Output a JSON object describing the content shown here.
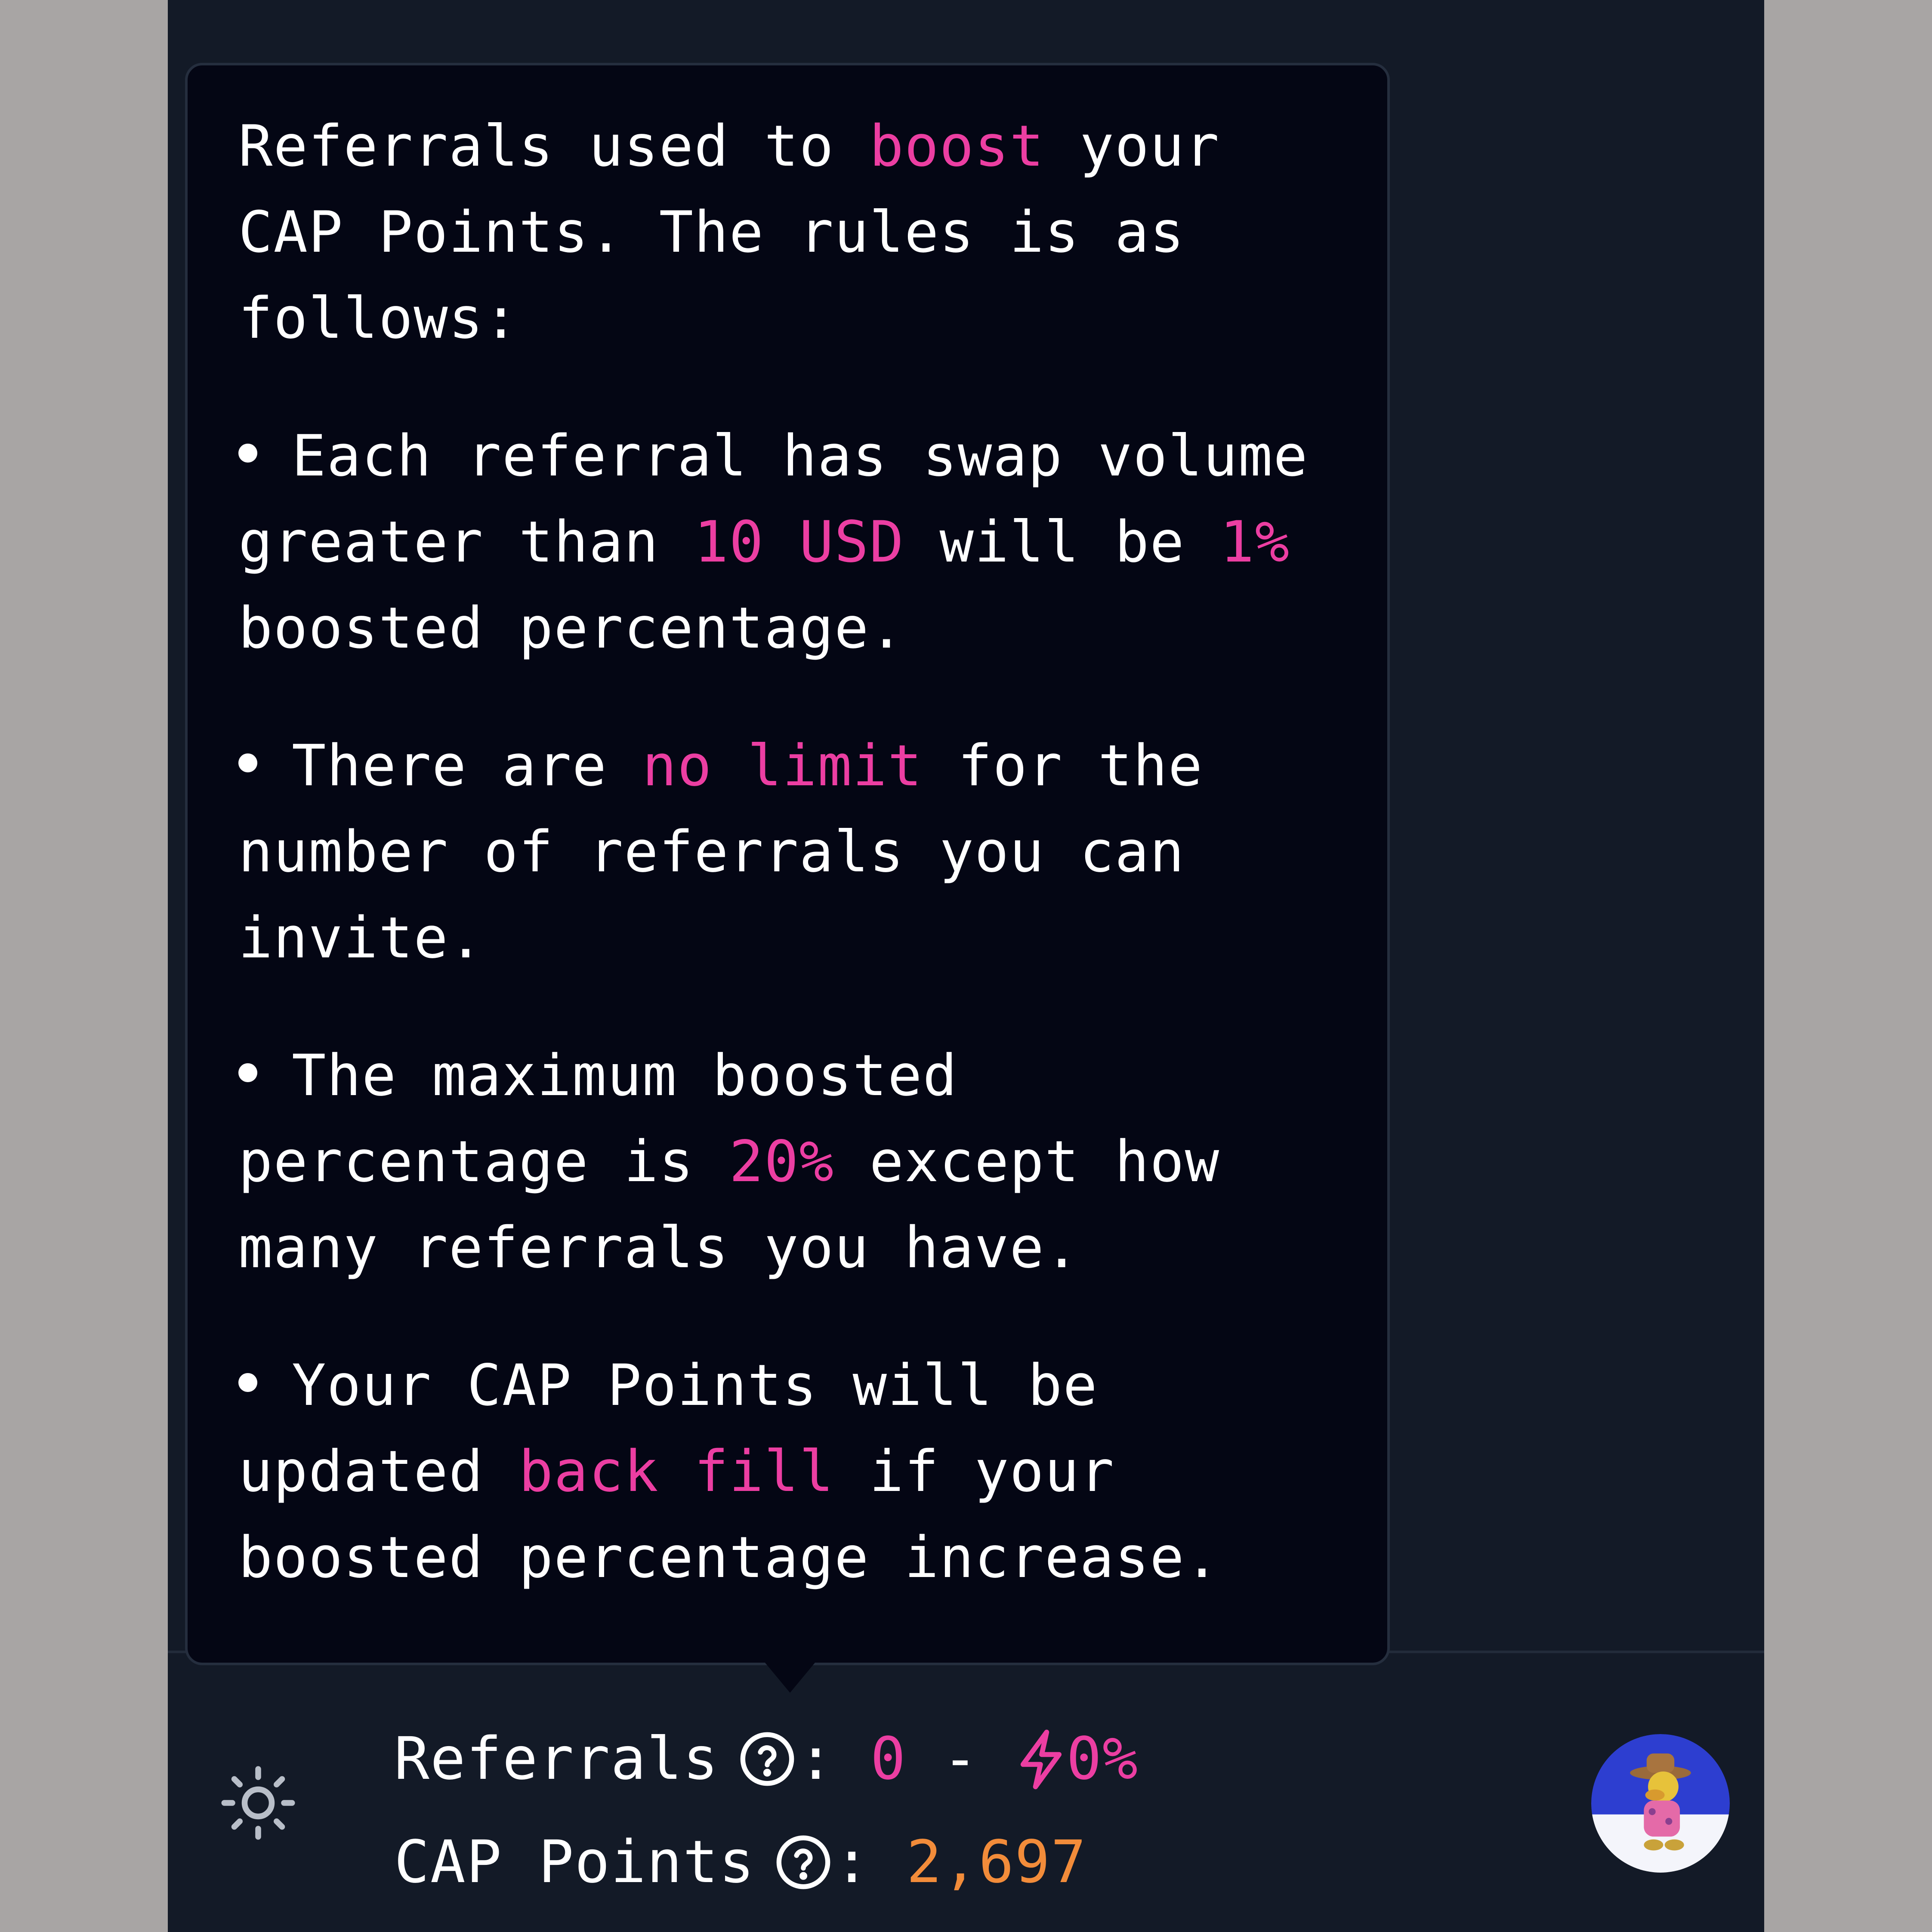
{
  "tooltip": {
    "intro": {
      "before": "Referrals used to ",
      "highlight": "boost",
      "after": " your CAP Points. The rules is as follows:"
    },
    "rules": [
      {
        "before": "Each referral has swap volume greater than ",
        "highlight": "10 USD",
        "middle": " will be ",
        "highlight2": "1%",
        "after": " boosted percentage."
      },
      {
        "before": "There are ",
        "highlight": "no limit",
        "after": " for the number of referrals you can invite."
      },
      {
        "before": "The maximum boosted percentage is ",
        "highlight": "20%",
        "after": " except how many referrals you have."
      },
      {
        "before": "Your CAP Points will be updated ",
        "highlight": "back fill",
        "after": " if your boosted percentage increase."
      }
    ]
  },
  "stats": {
    "referrals": {
      "label": "Referrals",
      "separator": ":",
      "count": "0",
      "dash": "-",
      "boost": "0%"
    },
    "cap_points": {
      "label": "CAP Points",
      "separator": ":",
      "value": "2,697"
    }
  },
  "icons": {
    "theme_toggle": "sun-icon",
    "help": "question-circle-icon",
    "boost": "lightning-bolt-icon",
    "avatar": "user-avatar"
  },
  "colors": {
    "accent_pink": "#ec3ea2",
    "accent_orange": "#f28c3a",
    "background": "#131a27",
    "tooltip_background": "#040614"
  }
}
